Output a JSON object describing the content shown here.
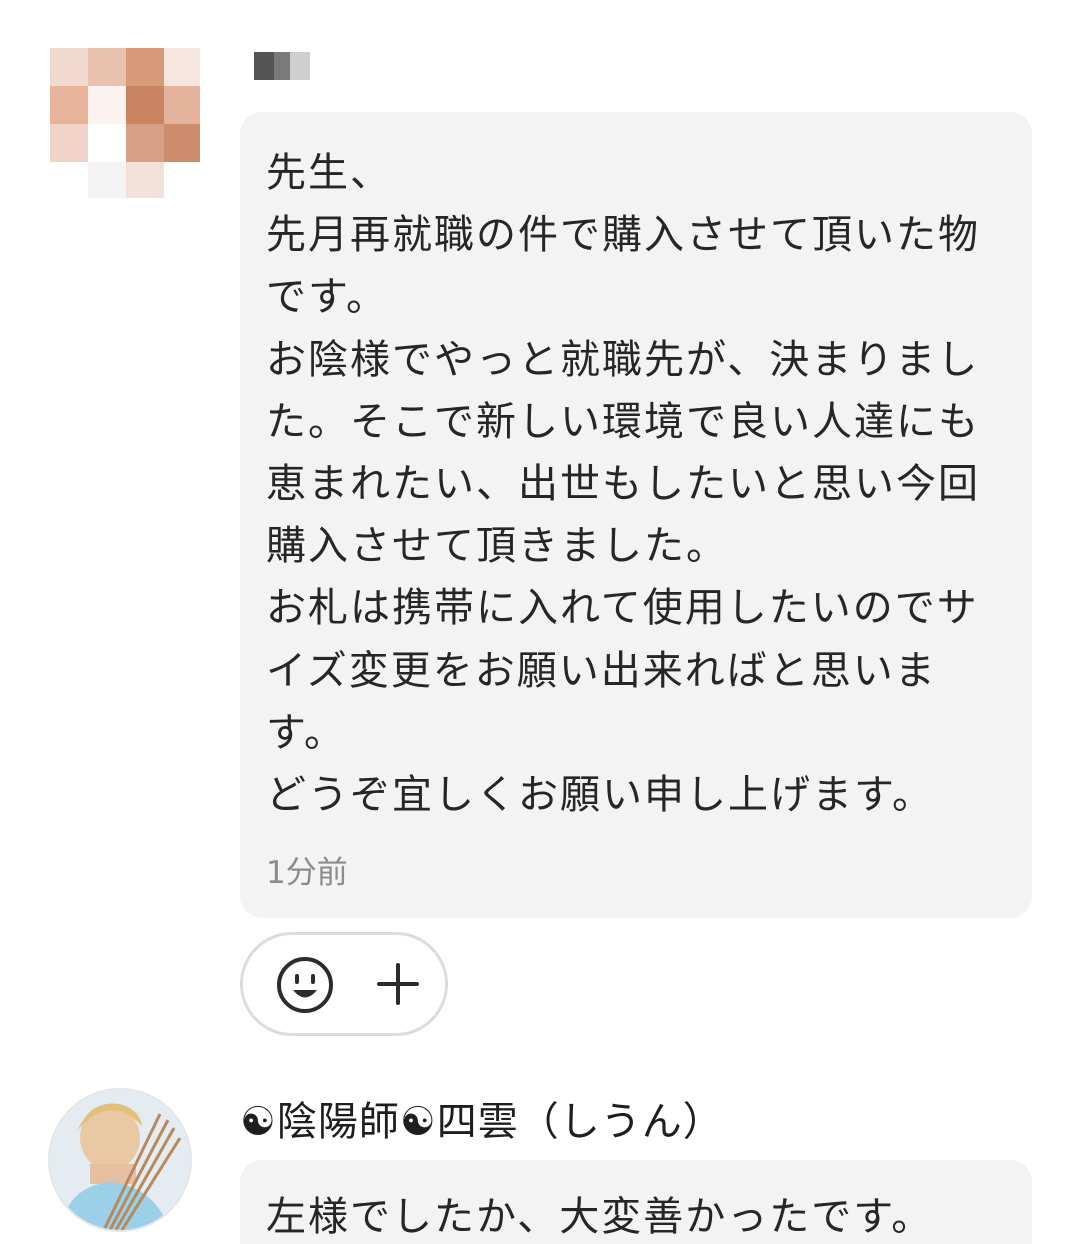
{
  "messages": [
    {
      "sender": "",
      "text": "先生、\n先月再就職の件で購入させて頂いた物です。\nお陰様でやっと就職先が、決まりました。そこで新しい環境で良い人達にも恵まれたい、出世もしたいと思い今回購入させて頂きました。\nお札は携帯に入れて使用したいのでサイズ変更をお願い出来ればと思います。\nどうぞ宜しくお願い申し上げます。",
      "timestamp": "1分前"
    },
    {
      "sender": "☯陰陽師☯四雲（しうん）",
      "text": "左様でしたか、大変善かったです。"
    }
  ],
  "reaction_bar": {
    "emoji_icon": "smiley-face-icon",
    "add_icon": "plus-icon"
  },
  "colors": {
    "bubble_bg": "#f3f3f3",
    "timestamp": "#8b8b8b",
    "text": "#262626",
    "reaction_border": "#dcdcdc"
  }
}
